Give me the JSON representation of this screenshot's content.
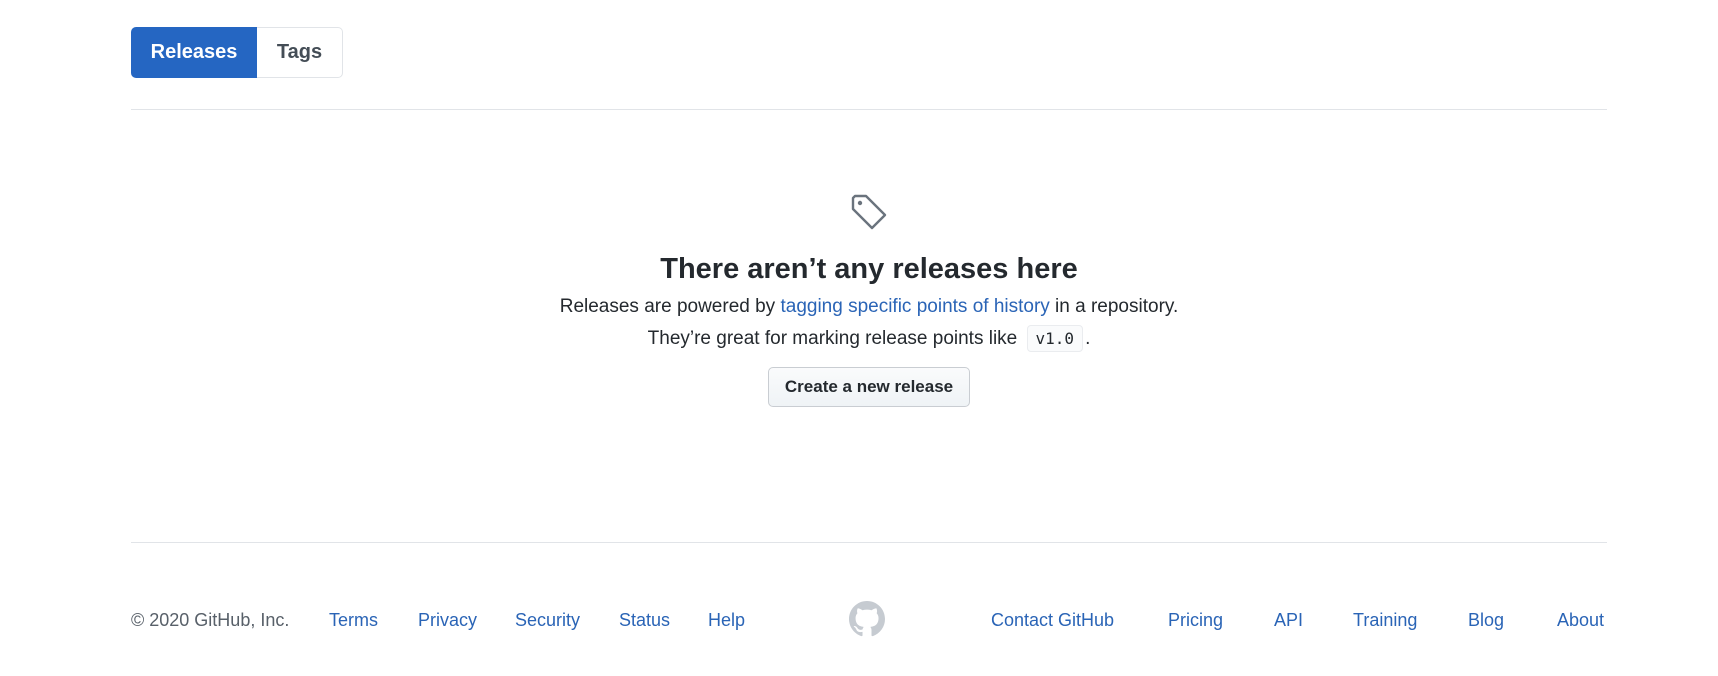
{
  "subnav": {
    "releases_label": "Releases",
    "tags_label": "Tags"
  },
  "blankslate": {
    "icon": "tag-icon",
    "title": "There aren’t any releases here",
    "line1_prefix": "Releases are powered by ",
    "line1_link": "tagging specific points of history",
    "line1_suffix": " in a repository.",
    "line2_prefix": "They’re great for marking release points like",
    "line2_code": "v1.0",
    "line2_suffix": ".",
    "button_label": "Create a new release"
  },
  "footer": {
    "copyright": "© 2020 GitHub, Inc.",
    "left_links": [
      "Terms",
      "Privacy",
      "Security",
      "Status",
      "Help"
    ],
    "logo_icon": "github-mark-icon",
    "right_links": [
      "Contact GitHub",
      "Pricing",
      "API",
      "Training",
      "Blog",
      "About"
    ]
  },
  "colors": {
    "accent": "#2566c2",
    "link": "#2a64b6",
    "border": "#e1e4e8"
  }
}
